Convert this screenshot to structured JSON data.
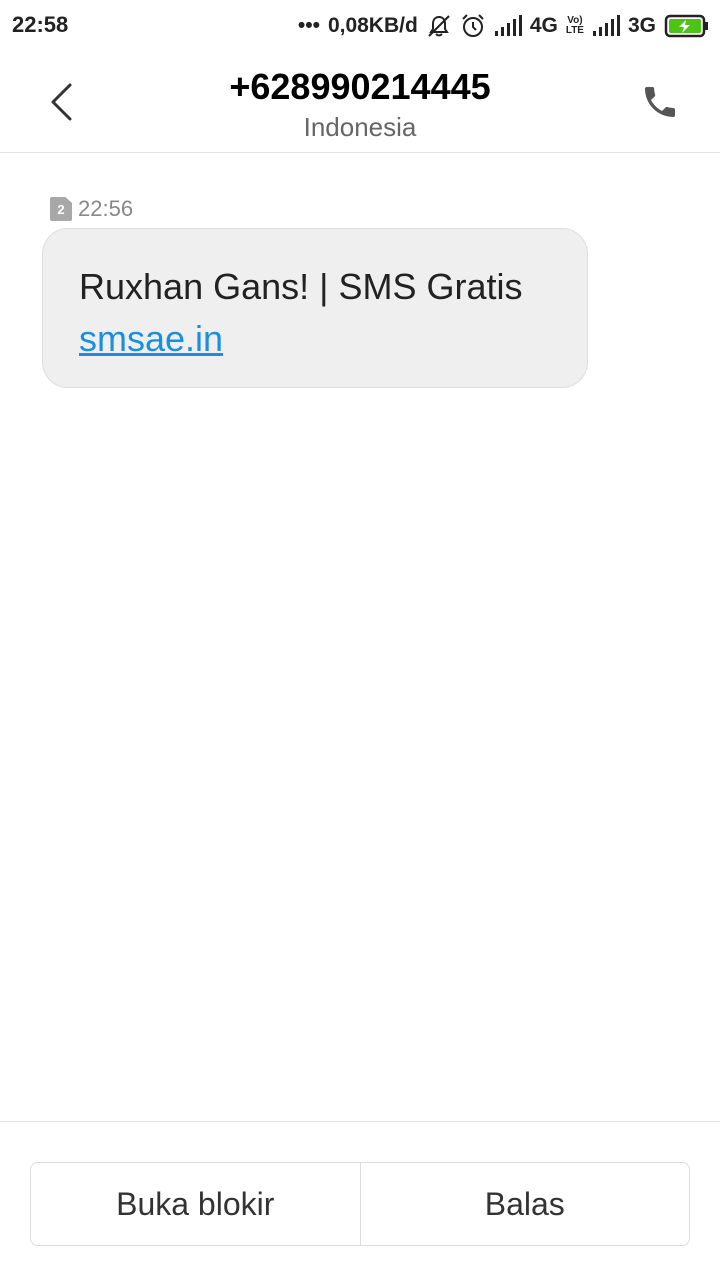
{
  "status_bar": {
    "time": "22:58",
    "dots": "•••",
    "network_speed": "0,08KB/d",
    "sim1_network": "4G",
    "volte_top": "Vo)",
    "volte_bottom": "LTE",
    "sim2_network": "3G",
    "icons": [
      "notifications-off-icon",
      "alarm-icon",
      "signal-icon",
      "signal-icon",
      "battery-charging-icon"
    ],
    "battery_color": "#4cc417"
  },
  "header": {
    "title": "+628990214445",
    "subtitle": "Indonesia",
    "back_icon": "chevron-left-icon",
    "call_icon": "phone-icon"
  },
  "message": {
    "sim_slot": "2",
    "time": "22:56",
    "text": "Ruxhan Gans! | SMS Gratis",
    "link": "smsae.in",
    "link_color": "#1a8fe0"
  },
  "actions": {
    "unblock_label": "Buka blokir",
    "reply_label": "Balas"
  }
}
